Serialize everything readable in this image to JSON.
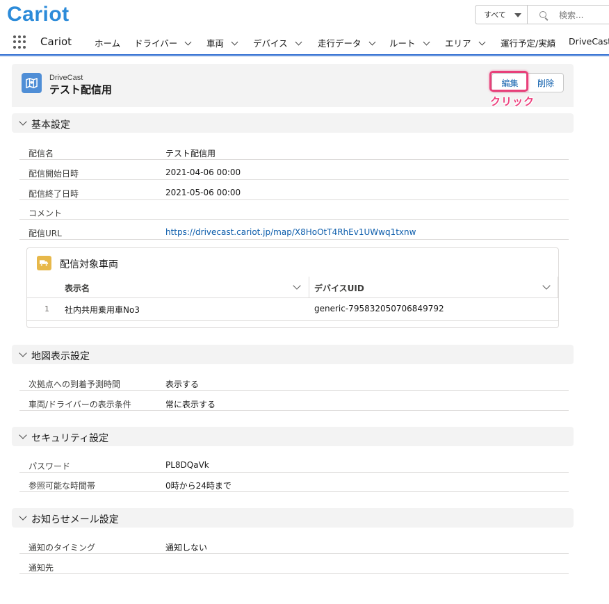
{
  "app": {
    "logo": "Cariot",
    "name": "Cariot",
    "search_scope": "すべて",
    "search_placeholder": "検索..."
  },
  "nav": [
    {
      "label": "ホーム",
      "has_menu": false
    },
    {
      "label": "ドライバー",
      "has_menu": true
    },
    {
      "label": "車両",
      "has_menu": true
    },
    {
      "label": "デバイス",
      "has_menu": true
    },
    {
      "label": "走行データ",
      "has_menu": true
    },
    {
      "label": "ルート",
      "has_menu": true
    },
    {
      "label": "エリア",
      "has_menu": true
    },
    {
      "label": "運行予定/実績",
      "has_menu": false
    },
    {
      "label": "DriveCast",
      "has_menu": false
    }
  ],
  "record": {
    "object_type": "DriveCast",
    "title": "テスト配信用",
    "edit_label": "編集",
    "delete_label": "削除",
    "annotation": "クリック"
  },
  "sections": {
    "basic": {
      "title": "基本設定",
      "fields": [
        {
          "label": "配信名",
          "value": "テスト配信用"
        },
        {
          "label": "配信開始日時",
          "value": "2021-04-06 00:00"
        },
        {
          "label": "配信終了日時",
          "value": "2021-05-06 00:00"
        },
        {
          "label": "コメント",
          "value": ""
        },
        {
          "label": "配信URL",
          "value": "https://drivecast.cariot.jp/map/X8HoOtT4RhEv1UWwq1txnw"
        }
      ]
    },
    "related": {
      "title": "配信対象車両",
      "columns": [
        "表示名",
        "デバイスUID"
      ],
      "rows": [
        {
          "num": "1",
          "name": "社内共用乗用車No3",
          "uid": "generic-795832050706849792"
        }
      ]
    },
    "map": {
      "title": "地図表示設定",
      "fields": [
        {
          "label": "次拠点への到着予測時間",
          "value": "表示する"
        },
        {
          "label": "車両/ドライバーの表示条件",
          "value": "常に表示する"
        }
      ]
    },
    "security": {
      "title": "セキュリティ設定",
      "fields": [
        {
          "label": "パスワード",
          "value": "PL8DQaVk"
        },
        {
          "label": "参照可能な時間帯",
          "value": "0時から24時まで"
        }
      ]
    },
    "mail": {
      "title": "お知らせメール設定",
      "fields": [
        {
          "label": "通知のタイミング",
          "value": "通知しない"
        },
        {
          "label": "通知先",
          "value": ""
        }
      ]
    }
  },
  "colors": {
    "brand": "#2c8bd9",
    "link": "#0b5cab",
    "highlight": "#e8407a"
  }
}
